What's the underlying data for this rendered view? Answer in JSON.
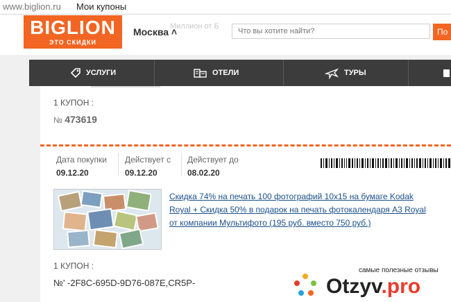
{
  "browser": {
    "url": "www.biglion.ru",
    "page_title": "Мои купоны"
  },
  "header": {
    "logo_name": "BIGLION",
    "logo_tagline": "ЭТО СКИДКИ",
    "city": "Москва ˄",
    "faded_text": "Миллион от Б",
    "search_placeholder": "Что вы хотите найти?",
    "search_button": "По"
  },
  "nav": {
    "items": [
      {
        "label": "УСЛУГИ",
        "icon": "tag-icon"
      },
      {
        "label": "ОТЕЛИ",
        "icon": "hotel-icon"
      },
      {
        "label": "ТУРЫ",
        "icon": "plane-icon"
      }
    ]
  },
  "coupon1": {
    "count_label": "1 КУПОН :",
    "number_prefix": "№",
    "number": "473619"
  },
  "dates": {
    "purchase_label": "Дата покупки",
    "purchase_value": "09.12.20",
    "valid_from_label": "Действует с",
    "valid_from_value": "09.12.20",
    "valid_to_label": "Действует до",
    "valid_to_value": "08.02.20"
  },
  "offer": {
    "description": "Скидка 74% на печать 100 фотографий 10х15 на бумаге Kodak Royal + Скидка 50% в подарок на печать фотокалендаря А3 Royal от компании Мультифото (195 руб. вместо 750 руб.)"
  },
  "coupon2": {
    "count_label": "1 КУПОН :",
    "code": "№'    -2F8C-695D-9D76-087E,CR5P-  "
  },
  "watermark": {
    "subtitle": "самые полезные отзывы",
    "brand_main": "Otzyv",
    "brand_dot_pro": ".pro"
  },
  "colors": {
    "brand_orange": "#f26522",
    "nav_dark": "#3c3c3c",
    "link_blue": "#1a4f8a"
  }
}
